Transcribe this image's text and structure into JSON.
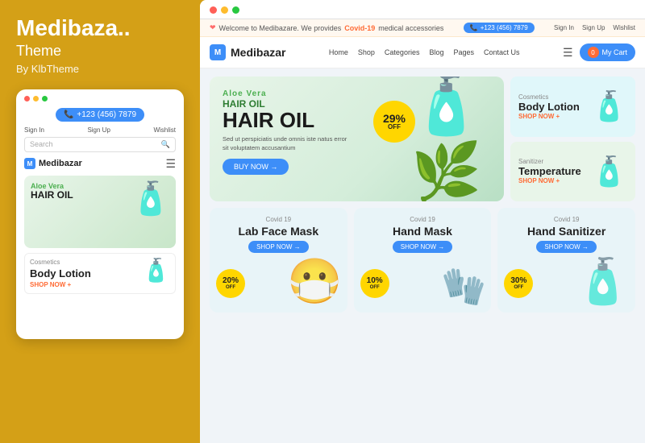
{
  "left": {
    "title": "Medibaza..",
    "subtitle": "Theme",
    "by": "By KlbTheme"
  },
  "mobile": {
    "phone": "+123 (456) 7879",
    "sign_in": "Sign In",
    "sign_up": "Sign Up",
    "wishlist": "Wishlist",
    "search_placeholder": "Search",
    "brand": "Medibazar",
    "hero_tag": "Aloe Vera",
    "hero_title": "HAIR OIL",
    "lotion_cat": "Cosmetics",
    "lotion_title": "Body Lotion",
    "lotion_shop": "SHOP NOW +"
  },
  "browser": {
    "notice": {
      "welcome": "Welcome to Medibazare. We provides",
      "covid": "Covid-19",
      "medical": "medical accessories",
      "phone": "+123 (456) 7879"
    },
    "top_right": {
      "sign_in": "Sign In",
      "sign_up": "Sign Up",
      "wishlist": "Wishlist"
    },
    "nav": {
      "logo": "Medibazar",
      "links": [
        "Home",
        "Shop",
        "Categories",
        "Blog",
        "Pages",
        "Contact Us"
      ],
      "cart_label": "My Cart",
      "cart_count": "0"
    },
    "hero": {
      "tag": "Aloe Vera",
      "title1": "HAIR OIL",
      "desc": "Sed ut perspiciatis unde omnis iste natus error sit voluptatem accusantium",
      "btn": "BUY NOW →",
      "badge_pct": "29%",
      "badge_off": "OFF"
    },
    "side_banners": [
      {
        "cat": "Cosmetics",
        "title": "Body Lotion",
        "shop": "SHOP NOW +"
      },
      {
        "cat": "Sanitizer",
        "title": "Temperature",
        "shop": "SHOP NOW +"
      }
    ],
    "cards": [
      {
        "label": "Covid 19",
        "title": "Lab Face Mask",
        "shop": "SHOP NOW →",
        "badge_pct": "20%",
        "badge_off": "OFF"
      },
      {
        "label": "Covid 19",
        "title": "Hand Mask",
        "shop": "SHOP NOW →",
        "badge_pct": "10%",
        "badge_off": "OFF"
      },
      {
        "label": "Covid 19",
        "title": "Hand Sanitizer",
        "shop": "SHOP NOW →",
        "badge_pct": "30%",
        "badge_off": "OFF"
      }
    ]
  }
}
